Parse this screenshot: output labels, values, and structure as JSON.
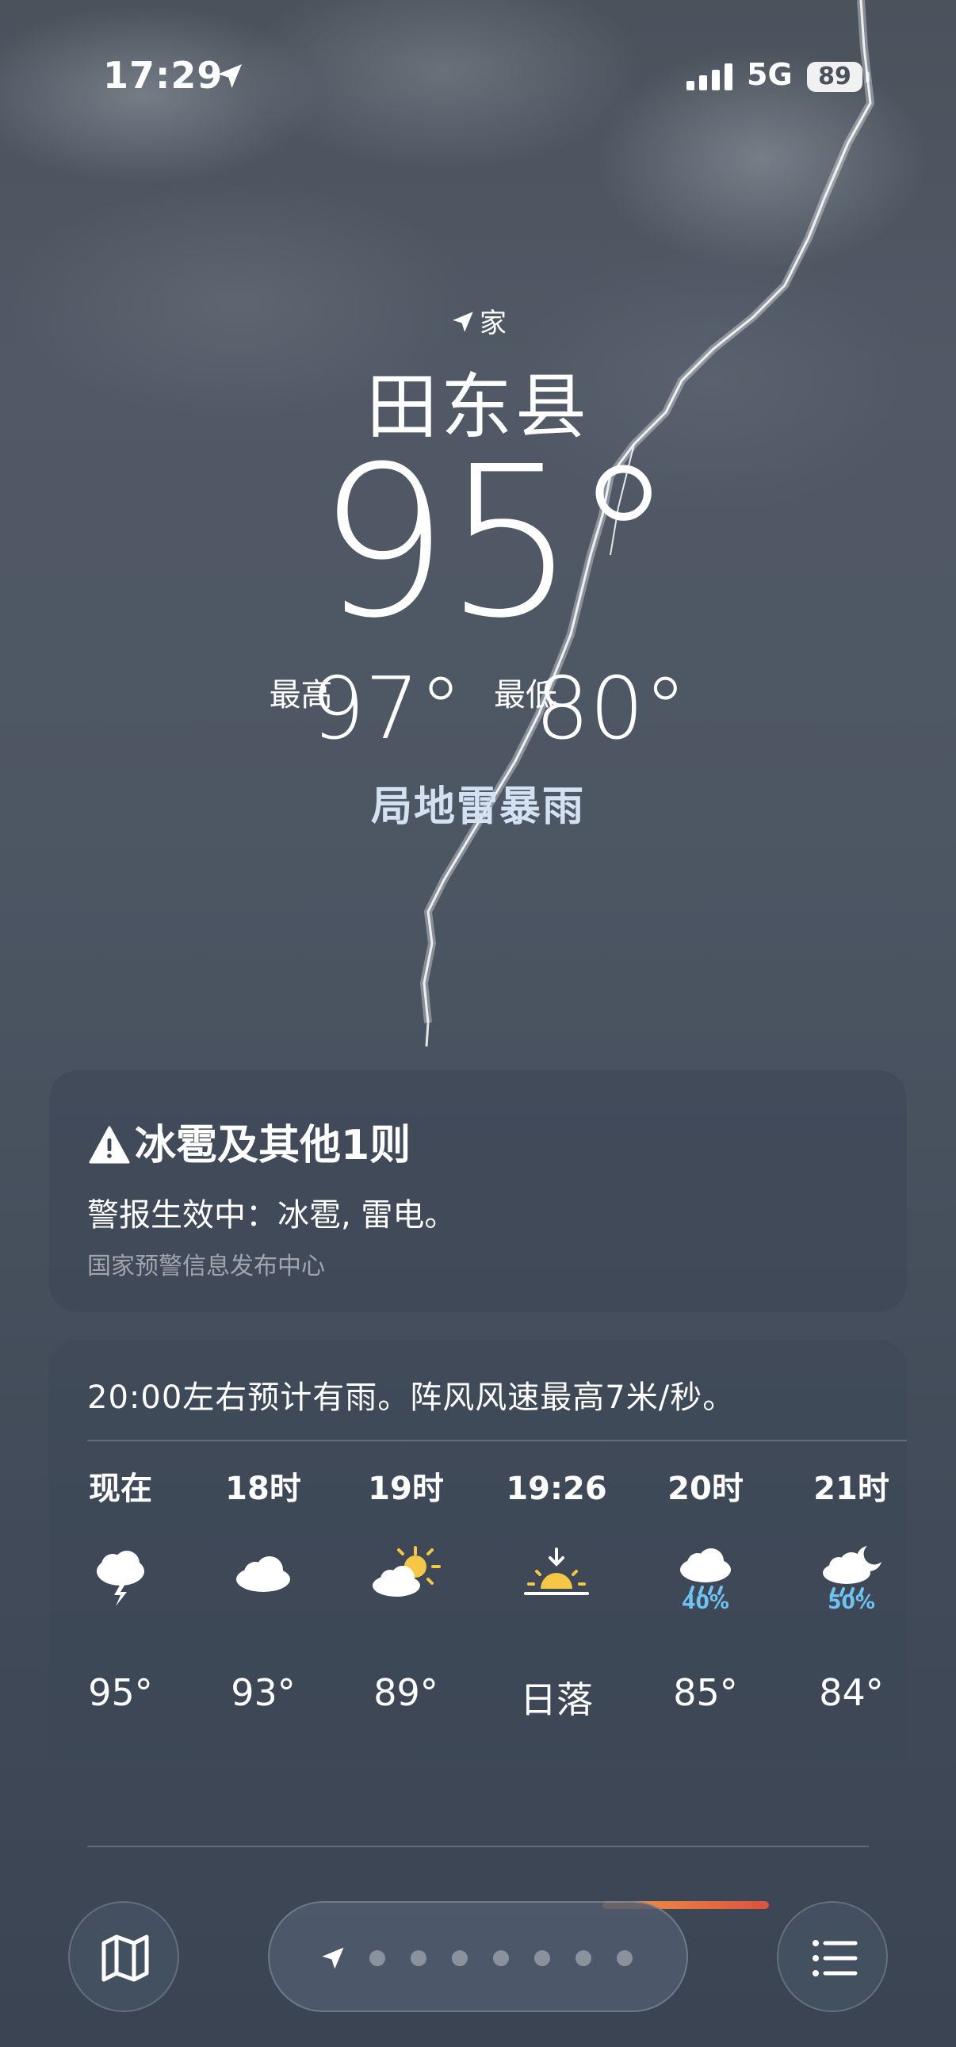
{
  "status_bar": {
    "time": "17:29",
    "network": "5G",
    "battery": "89"
  },
  "location": {
    "label": "家",
    "city": "田东县"
  },
  "current": {
    "temp": "95°",
    "high_label": "最高",
    "high": "97°",
    "low_label": "最低",
    "low": "80°",
    "condition": "局地雷暴雨"
  },
  "alert": {
    "title": "冰雹及其他1则",
    "body": "警报生效中：冰雹, 雷电。",
    "source": "国家预警信息发布中心"
  },
  "hourly": {
    "summary": "20:00左右预计有雨。阵风风速最高7米/秒。",
    "items": [
      {
        "label": "现在",
        "icon": "thunderstorm-icon",
        "temp": "95°"
      },
      {
        "label": "18时",
        "icon": "cloud-icon",
        "temp": "93°"
      },
      {
        "label": "19时",
        "icon": "partly-sunny-icon",
        "temp": "89°"
      },
      {
        "label": "19:26",
        "icon": "sunset-icon",
        "temp": "日落"
      },
      {
        "label": "20时",
        "icon": "rain-icon",
        "precip": "40%",
        "temp": "85°"
      },
      {
        "label": "21时",
        "icon": "night-rain-icon",
        "precip": "50%",
        "temp": "84°"
      }
    ]
  },
  "colors": {
    "precip": "#6ec3f2",
    "condition_text": "#d4e1f2",
    "sun": "#f6c744"
  },
  "toolbar": {
    "map_icon": "map-icon",
    "list_icon": "list-icon",
    "pages": 7
  }
}
